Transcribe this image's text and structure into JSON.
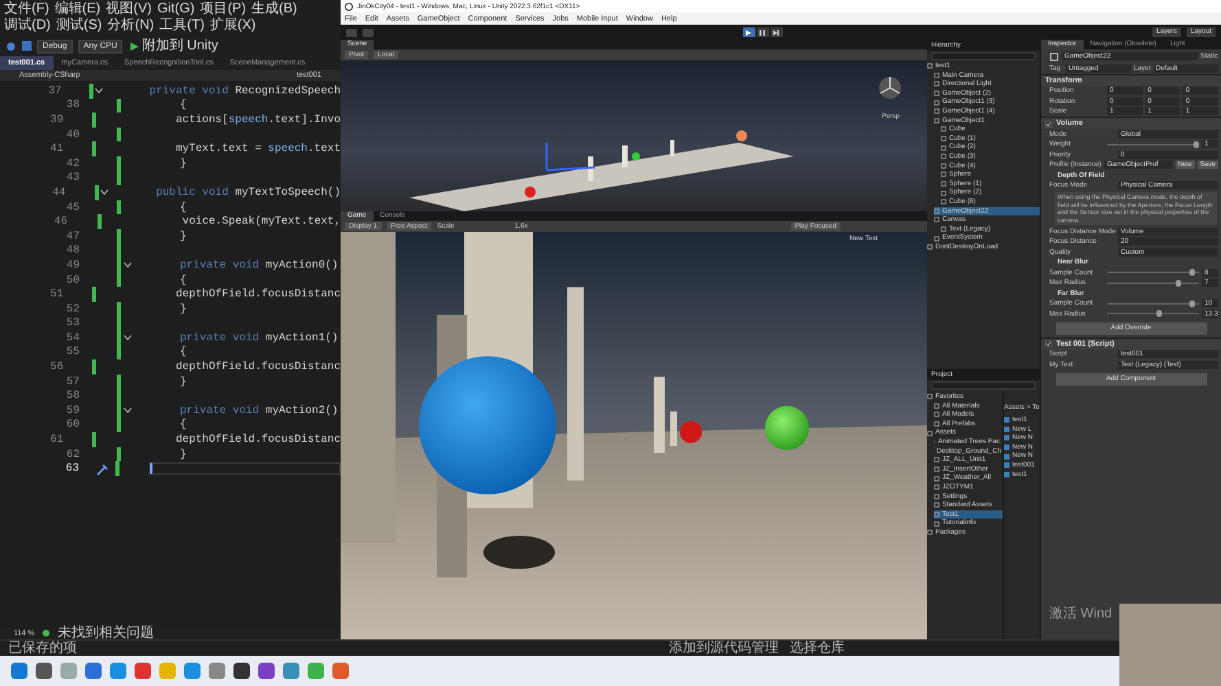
{
  "vs": {
    "menu": [
      "文件(F)",
      "编辑(E)",
      "视图(V)",
      "Git(G)",
      "项目(P)",
      "生成(B)",
      "调试(D)",
      "测试(S)",
      "分析(N)",
      "工具(T)",
      "扩展(X)"
    ],
    "toolbar": {
      "config": "Debug",
      "platform": "Any CPU",
      "run": "附加到 Unity"
    },
    "tabs": [
      {
        "label": "test001.cs",
        "selected": true
      },
      {
        "label": "myCamera.cs",
        "selected": false
      },
      {
        "label": "SpeechRecognitionTool.cs",
        "selected": false
      },
      {
        "label": "SceneManagement.cs",
        "selected": false
      }
    ],
    "nav": {
      "project": "Assembly-CSharp",
      "member": "test001"
    },
    "code": [
      {
        "number": "37",
        "kind": "signature",
        "current": false,
        "code": [
          {
            "text": "private void ",
            "kind": "keyword"
          },
          {
            "text": "RecognizedSpeech",
            "kind": "plain"
          }
        ]
      },
      {
        "number": "38",
        "kind": "brace",
        "current": false,
        "code": [
          {
            "text": "{",
            "kind": "plain"
          }
        ]
      },
      {
        "number": "39",
        "kind": "statement",
        "current": false,
        "code": [
          {
            "text": "actions[",
            "kind": "plain"
          },
          {
            "text": "speech",
            "kind": "name"
          },
          {
            "text": ".text].Invo",
            "kind": "plain"
          }
        ]
      },
      {
        "number": "40",
        "kind": "blank",
        "current": false
      },
      {
        "number": "41",
        "kind": "statement",
        "current": false,
        "code": [
          {
            "text": "myText.text = ",
            "kind": "plain"
          },
          {
            "text": "speech",
            "kind": "name"
          },
          {
            "text": ".text",
            "kind": "plain"
          }
        ]
      },
      {
        "number": "42",
        "kind": "brace",
        "current": false,
        "code": [
          {
            "text": "}",
            "kind": "plain"
          }
        ]
      },
      {
        "number": "43",
        "kind": "blank",
        "current": false
      },
      {
        "number": "44",
        "kind": "signature",
        "current": false,
        "code": [
          {
            "text": "public void ",
            "kind": "keyword"
          },
          {
            "text": "myTextToSpeech()",
            "kind": "plain"
          }
        ]
      },
      {
        "number": "45",
        "kind": "brace",
        "current": false,
        "code": [
          {
            "text": "{",
            "kind": "plain"
          }
        ]
      },
      {
        "number": "46",
        "kind": "statement",
        "current": false,
        "code": [
          {
            "text": "voice.Speak(myText.text,",
            "kind": "plain"
          }
        ]
      },
      {
        "number": "47",
        "kind": "brace",
        "current": false,
        "code": [
          {
            "text": "}",
            "kind": "plain"
          }
        ]
      },
      {
        "number": "48",
        "kind": "blank",
        "current": false
      },
      {
        "number": "49",
        "kind": "signature",
        "current": false,
        "code": [
          {
            "text": "private void ",
            "kind": "keyword"
          },
          {
            "text": "myAction0()",
            "kind": "plain"
          }
        ]
      },
      {
        "number": "50",
        "kind": "brace",
        "current": false,
        "code": [
          {
            "text": "{",
            "kind": "plain"
          }
        ]
      },
      {
        "number": "51",
        "kind": "statement",
        "current": false,
        "code": [
          {
            "text": "depthOfField.focusDistanc",
            "kind": "plain"
          }
        ]
      },
      {
        "number": "52",
        "kind": "brace",
        "current": false,
        "code": [
          {
            "text": "}",
            "kind": "plain"
          }
        ]
      },
      {
        "number": "53",
        "kind": "blank",
        "current": false
      },
      {
        "number": "54",
        "kind": "signature",
        "current": false,
        "code": [
          {
            "text": "private void ",
            "kind": "keyword"
          },
          {
            "text": "myAction1()",
            "kind": "plain"
          }
        ]
      },
      {
        "number": "55",
        "kind": "brace",
        "current": false,
        "code": [
          {
            "text": "{",
            "kind": "plain"
          }
        ]
      },
      {
        "number": "56",
        "kind": "statement",
        "current": false,
        "code": [
          {
            "text": "depthOfField.focusDistanc",
            "kind": "plain"
          }
        ]
      },
      {
        "number": "57",
        "kind": "brace",
        "current": false,
        "code": [
          {
            "text": "}",
            "kind": "plain"
          }
        ]
      },
      {
        "number": "58",
        "kind": "blank",
        "current": false
      },
      {
        "number": "59",
        "kind": "signature",
        "current": false,
        "code": [
          {
            "text": "private void ",
            "kind": "keyword"
          },
          {
            "text": "myAction2()",
            "kind": "plain"
          }
        ]
      },
      {
        "number": "60",
        "kind": "brace",
        "current": false,
        "code": [
          {
            "text": "{",
            "kind": "plain"
          }
        ]
      },
      {
        "number": "61",
        "kind": "statement",
        "current": false,
        "code": [
          {
            "text": "depthOfField.focusDistanc",
            "kind": "plain"
          }
        ]
      },
      {
        "number": "62",
        "kind": "brace",
        "current": false,
        "code": [
          {
            "text": "}",
            "kind": "plain"
          }
        ]
      },
      {
        "number": "63",
        "kind": "blank",
        "current": true
      }
    ],
    "zoom": "114 %",
    "issues": "未找到相关问题"
  },
  "status_bar": {
    "left": "已保存的项",
    "source_control": [
      "添加到源代码管理",
      "选择仓库"
    ]
  },
  "unity": {
    "title": "JinOkCity04 - test1 - Windows, Mac, Linux - Unity 2022.3.62f1c1 <DX11>",
    "menu": [
      "File",
      "Edit",
      "Assets",
      "GameObject",
      "Component",
      "Services",
      "Jobs",
      "Mobile Input",
      "Window",
      "Help"
    ],
    "toolbar": {
      "layers": "Layers",
      "layout": "Layout"
    },
    "scene": {
      "tab": "Scene",
      "pivot": "Pivot",
      "local": "Local",
      "persp": "Persp"
    },
    "game": {
      "tabs": [
        {
          "label": "Game",
          "selected": true
        },
        {
          "label": "Console",
          "selected": false
        }
      ],
      "display": "Display 1",
      "aspect": "Free Aspect",
      "scale_label": "Scale",
      "scale": "1.6x",
      "play": "Play Focused",
      "overlay_text": "New Text"
    },
    "hierarchy": {
      "title": "Hierarchy",
      "items": [
        {
          "label": "test1",
          "selected": false,
          "children": [
            {
              "label": "Main Camera",
              "selected": false
            },
            {
              "label": "Directional Light",
              "selected": false
            },
            {
              "label": "GameObject (2)",
              "selected": false
            },
            {
              "label": "GameObject1 (3)",
              "selected": false
            },
            {
              "label": "GameObject1 (4)",
              "selected": false
            },
            {
              "label": "GameObject1",
              "selected": false,
              "children": [
                {
                  "label": "Cube",
                  "selected": false
                },
                {
                  "label": "Cube (1)",
                  "selected": false
                },
                {
                  "label": "Cube (2)",
                  "selected": false
                },
                {
                  "label": "Cube (3)",
                  "selected": false
                },
                {
                  "label": "Cube (4)",
                  "selected": false
                },
                {
                  "label": "Sphere",
                  "selected": false
                },
                {
                  "label": "Sphere (1)",
                  "selected": false
                },
                {
                  "label": "Sphere (2)",
                  "selected": false
                },
                {
                  "label": "Cube (6)",
                  "selected": false
                }
              ]
            },
            {
              "label": "GameObject22",
              "selected": true
            },
            {
              "label": "Canvas",
              "selected": false,
              "children": [
                {
                  "label": "Text (Legacy)",
                  "selected": false
                }
              ]
            },
            {
              "label": "EventSystem",
              "selected": false
            }
          ]
        },
        {
          "label": "DontDestroyOnLoad",
          "selected": false
        }
      ]
    },
    "inspector": {
      "tabs": [
        {
          "label": "Inspector",
          "selected": true
        },
        {
          "label": "Navigation (Obsolete)",
          "selected": false
        },
        {
          "label": "Light",
          "selected": false
        }
      ],
      "object": {
        "name": "GameObject22",
        "static": "Static",
        "tag_label": "Tag",
        "tag": "Untagged",
        "layer_label": "Layer",
        "layer": "Default"
      },
      "components": [
        {
          "title": "Transform",
          "rows": [
            {
              "kind": "vector",
              "label": "Position",
              "values": [
                "0",
                "0",
                "0"
              ]
            },
            {
              "kind": "vector",
              "label": "Rotation",
              "values": [
                "0",
                "0",
                "0"
              ]
            },
            {
              "kind": "vector",
              "label": "Scale",
              "values": [
                "1",
                "1",
                "1"
              ]
            }
          ]
        },
        {
          "title": "Volume",
          "enabled": true,
          "rows": [
            {
              "kind": "field",
              "label": "Mode",
              "value": "Global"
            },
            {
              "kind": "slider",
              "label": "Weight",
              "value": "1",
              "level": 1
            },
            {
              "kind": "field",
              "label": "Priority",
              "value": "0"
            },
            {
              "kind": "field",
              "label": "Profile (Instance)",
              "value": "GameObjectProf",
              "buttons": [
                "New",
                "Save"
              ]
            },
            {
              "kind": "section",
              "label": "Depth Of Field"
            },
            {
              "kind": "field",
              "label": "Focus Mode",
              "value": "Physical Camera"
            },
            {
              "kind": "help",
              "label": "When using the Physical Camera mode, the depth of field will be influenced by the Aperture, the Focus Length and the Sensor size set in the physical properties of the camera."
            },
            {
              "kind": "field",
              "label": "Focus Distance Mode",
              "value": "Volume"
            },
            {
              "kind": "field",
              "label": "Focus Distance",
              "value": "20"
            },
            {
              "kind": "field",
              "label": "Quality",
              "value": "Custom"
            },
            {
              "kind": "section",
              "label": "Near Blur"
            },
            {
              "kind": "slider",
              "label": "Sample Count",
              "value": "8",
              "level": 0.95
            },
            {
              "kind": "slider",
              "label": "Max Radius",
              "value": "7",
              "level": 0.8
            },
            {
              "kind": "section",
              "label": "Far Blur"
            },
            {
              "kind": "slider",
              "label": "Sample Count",
              "value": "10",
              "level": 0.95
            },
            {
              "kind": "slider",
              "label": "Max Radius",
              "value": "13.3",
              "level": 0.6
            },
            {
              "kind": "button",
              "label": "Add Override"
            }
          ]
        },
        {
          "title": "Test 001 (Script)",
          "enabled": true,
          "rows": [
            {
              "kind": "field",
              "label": "Script",
              "value": "test001"
            },
            {
              "kind": "field",
              "label": "My Text",
              "value": "Text (Legacy) (Text)"
            }
          ]
        }
      ],
      "add_component": "Add Component"
    },
    "project": {
      "title": "Project",
      "tree": [
        {
          "label": "Favorites",
          "selected": false,
          "children": [
            {
              "label": "All Materials",
              "selected": false
            },
            {
              "label": "All Models",
              "selected": false
            },
            {
              "label": "All Prefabs",
              "selected": false
            }
          ]
        },
        {
          "label": "Assets",
          "selected": false,
          "children": [
            {
              "label": "Animated Trees Pac",
              "selected": false
            },
            {
              "label": "Desktop_Ground_Ch",
              "selected": false
            },
            {
              "label": "JZ_ALL_Unit1",
              "selected": false
            },
            {
              "label": "JZ_InsertOther",
              "selected": false
            },
            {
              "label": "JZ_Weather_All",
              "selected": false
            },
            {
              "label": "JZOTYM1",
              "selected": false
            },
            {
              "label": "Settings",
              "selected": false
            },
            {
              "label": "Standard Assets",
              "selected": false
            },
            {
              "label": "Test1",
              "selected": true
            },
            {
              "label": "Tutorialinfo",
              "selected": false
            }
          ]
        },
        {
          "label": "Packages",
          "selected": false
        }
      ],
      "path": "Assets > Te",
      "files": [
        "test1",
        "New L",
        "New N",
        "New N",
        "New N",
        "test001",
        "test1"
      ]
    }
  },
  "activation_text": "激活 Wind"
}
